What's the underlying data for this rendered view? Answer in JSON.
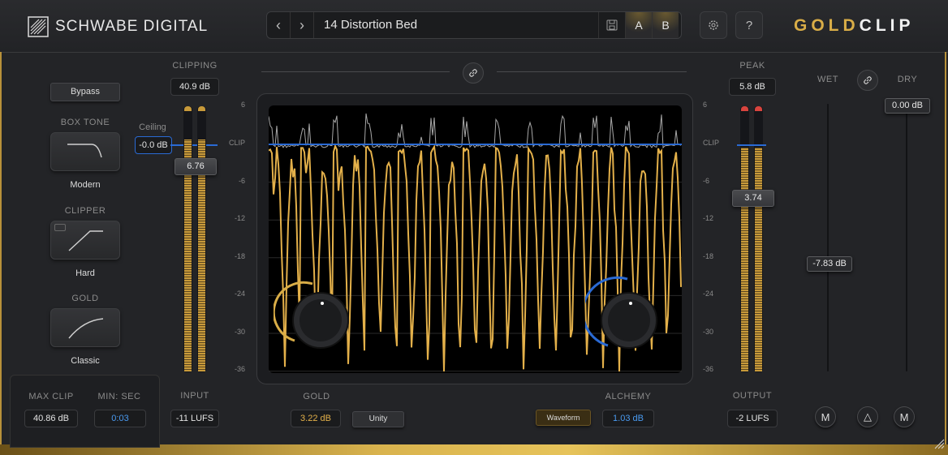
{
  "header": {
    "brand": "SCHWABE DIGITAL",
    "preset_name": "14 Distortion Bed",
    "prev_icon": "chevron-left-icon",
    "next_icon": "chevron-right-icon",
    "save_icon": "save-icon",
    "a_label": "A",
    "b_label": "B",
    "settings_icon": "gear-icon",
    "help_label": "?",
    "product_gold": "GOLD",
    "product_clip": "CLIP"
  },
  "left": {
    "bypass_label": "Bypass",
    "box_tone_label": "BOX TONE",
    "box_tone_value": "Modern",
    "clipper_label": "CLIPPER",
    "clipper_value": "Hard",
    "gold_label": "GOLD",
    "gold_value": "Classic",
    "max_clip_label": "MAX CLIP",
    "max_clip_value": "40.86 dB",
    "min_sec_label": "MIN: SEC",
    "min_sec_value": "0:03"
  },
  "input": {
    "clipping_label": "CLIPPING",
    "clipping_value": "40.9 dB",
    "ceiling_label": "Ceiling",
    "ceiling_value": "-0.0 dB",
    "slider_value": "6.76",
    "input_label": "INPUT",
    "input_value": "-11 LUFS"
  },
  "display": {
    "scale": [
      "6",
      "CLIP",
      "-6",
      "-12",
      "-18",
      "-24",
      "-30",
      "-36"
    ],
    "link_icon": "link-icon",
    "gold_label": "GOLD",
    "gold_value": "3.22 dB",
    "unity_label": "Unity",
    "waveform_label": "Waveform",
    "alchemy_label": "ALCHEMY",
    "alchemy_value": "1.03 dB"
  },
  "output": {
    "peak_label": "PEAK",
    "peak_value": "5.8 dB",
    "slider_value": "3.74",
    "output_label": "OUTPUT",
    "output_value": "-2 LUFS"
  },
  "mix": {
    "wet_label": "WET",
    "dry_label": "DRY",
    "link_icon": "link-icon",
    "dry_value": "0.00 dB",
    "wet_value": "-7.83 dB",
    "m1_label": "M",
    "delta_label": "△",
    "m2_label": "M"
  },
  "colors": {
    "gold": "#d9ad47",
    "clip_line": "#2a6ad4",
    "meter_red": "#d9443e",
    "blue_value": "#4a9af0"
  }
}
